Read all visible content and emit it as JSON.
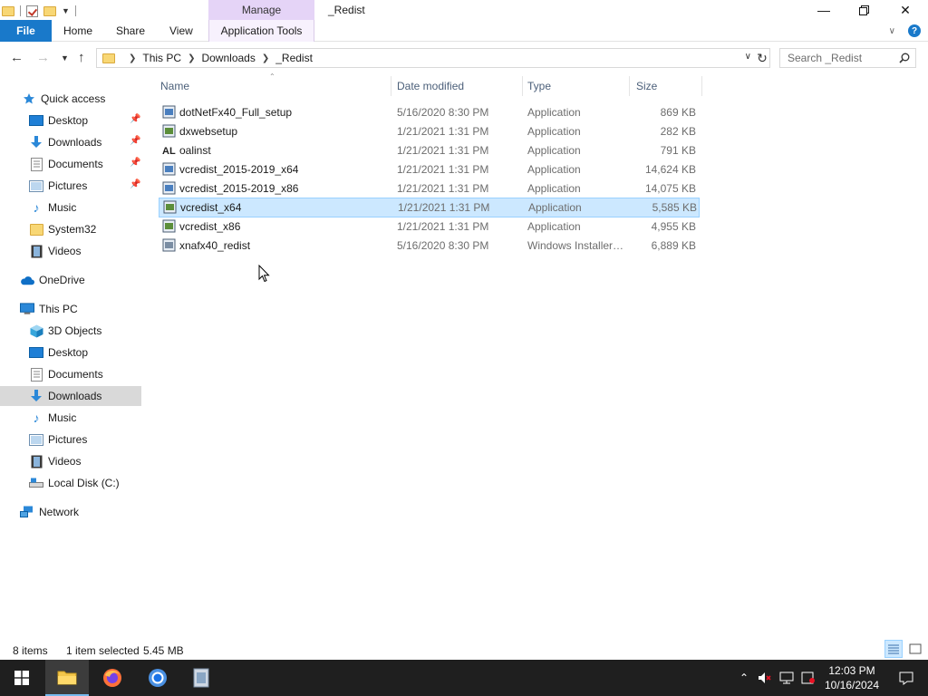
{
  "window": {
    "title": "_Redist",
    "contextual_tab": "Manage",
    "controls": {
      "minimize": "—",
      "maximize": "❐",
      "close": "✕"
    }
  },
  "ribbon": {
    "tabs": [
      "File",
      "Home",
      "Share",
      "View"
    ],
    "contextual_group_label": "Application Tools"
  },
  "address": {
    "breadcrumb": [
      "This PC",
      "Downloads",
      "_Redist"
    ],
    "search_placeholder": "Search _Redist"
  },
  "sidebar": {
    "quick_access": {
      "label": "Quick access",
      "items": [
        {
          "label": "Desktop",
          "icon": "desktop-icon",
          "pinned": true
        },
        {
          "label": "Downloads",
          "icon": "downloads-icon",
          "pinned": true
        },
        {
          "label": "Documents",
          "icon": "documents-icon",
          "pinned": true
        },
        {
          "label": "Pictures",
          "icon": "pictures-icon",
          "pinned": true
        },
        {
          "label": "Music",
          "icon": "music-icon",
          "pinned": false
        },
        {
          "label": "System32",
          "icon": "folder-icon",
          "pinned": false
        },
        {
          "label": "Videos",
          "icon": "videos-icon",
          "pinned": false
        }
      ]
    },
    "onedrive": "OneDrive",
    "this_pc": {
      "label": "This PC",
      "items": [
        {
          "label": "3D Objects",
          "icon": "3d-objects-icon"
        },
        {
          "label": "Desktop",
          "icon": "desktop-icon"
        },
        {
          "label": "Documents",
          "icon": "documents-icon"
        },
        {
          "label": "Downloads",
          "icon": "downloads-icon",
          "selected": true
        },
        {
          "label": "Music",
          "icon": "music-icon"
        },
        {
          "label": "Pictures",
          "icon": "pictures-icon"
        },
        {
          "label": "Videos",
          "icon": "videos-icon"
        },
        {
          "label": "Local Disk (C:)",
          "icon": "drive-icon"
        }
      ]
    },
    "network": "Network"
  },
  "columns": [
    "Name",
    "Date modified",
    "Type",
    "Size"
  ],
  "files": [
    {
      "name": "dotNetFx40_Full_setup",
      "date": "5/16/2020 8:30 PM",
      "type": "Application",
      "size": "869 KB",
      "icon": "installer-icon"
    },
    {
      "name": "dxwebsetup",
      "date": "1/21/2021 1:31 PM",
      "type": "Application",
      "size": "282 KB",
      "icon": "installer-icon"
    },
    {
      "name": "oalinst",
      "date": "1/21/2021 1:31 PM",
      "type": "Application",
      "size": "791 KB",
      "icon": "openal-icon"
    },
    {
      "name": "vcredist_2015-2019_x64",
      "date": "1/21/2021 1:31 PM",
      "type": "Application",
      "size": "14,624 KB",
      "icon": "installer-icon"
    },
    {
      "name": "vcredist_2015-2019_x86",
      "date": "1/21/2021 1:31 PM",
      "type": "Application",
      "size": "14,075 KB",
      "icon": "installer-icon"
    },
    {
      "name": "vcredist_x64",
      "date": "1/21/2021 1:31 PM",
      "type": "Application",
      "size": "5,585 KB",
      "icon": "installer-icon",
      "selected": true
    },
    {
      "name": "vcredist_x86",
      "date": "1/21/2021 1:31 PM",
      "type": "Application",
      "size": "4,955 KB",
      "icon": "installer-icon"
    },
    {
      "name": "xnafx40_redist",
      "date": "5/16/2020 8:30 PM",
      "type": "Windows Installer ...",
      "size": "6,889 KB",
      "icon": "msi-icon"
    }
  ],
  "status": {
    "item_count": "8 items",
    "selection": "1 item selected",
    "selection_size": "5.45 MB"
  },
  "taskbar": {
    "apps": [
      "start-icon",
      "file-explorer-icon",
      "firefox-icon",
      "chrome-icon",
      "app-icon"
    ],
    "time": "12:03 PM",
    "date": "10/16/2024"
  },
  "colors": {
    "accent": "#1979ca",
    "contextual_tab": "#e5d4f7",
    "selection_bg": "#cce8ff",
    "selection_border": "#99d1ff",
    "nav_selected": "#d9d9d9",
    "taskbar": "#1f1f1f"
  }
}
